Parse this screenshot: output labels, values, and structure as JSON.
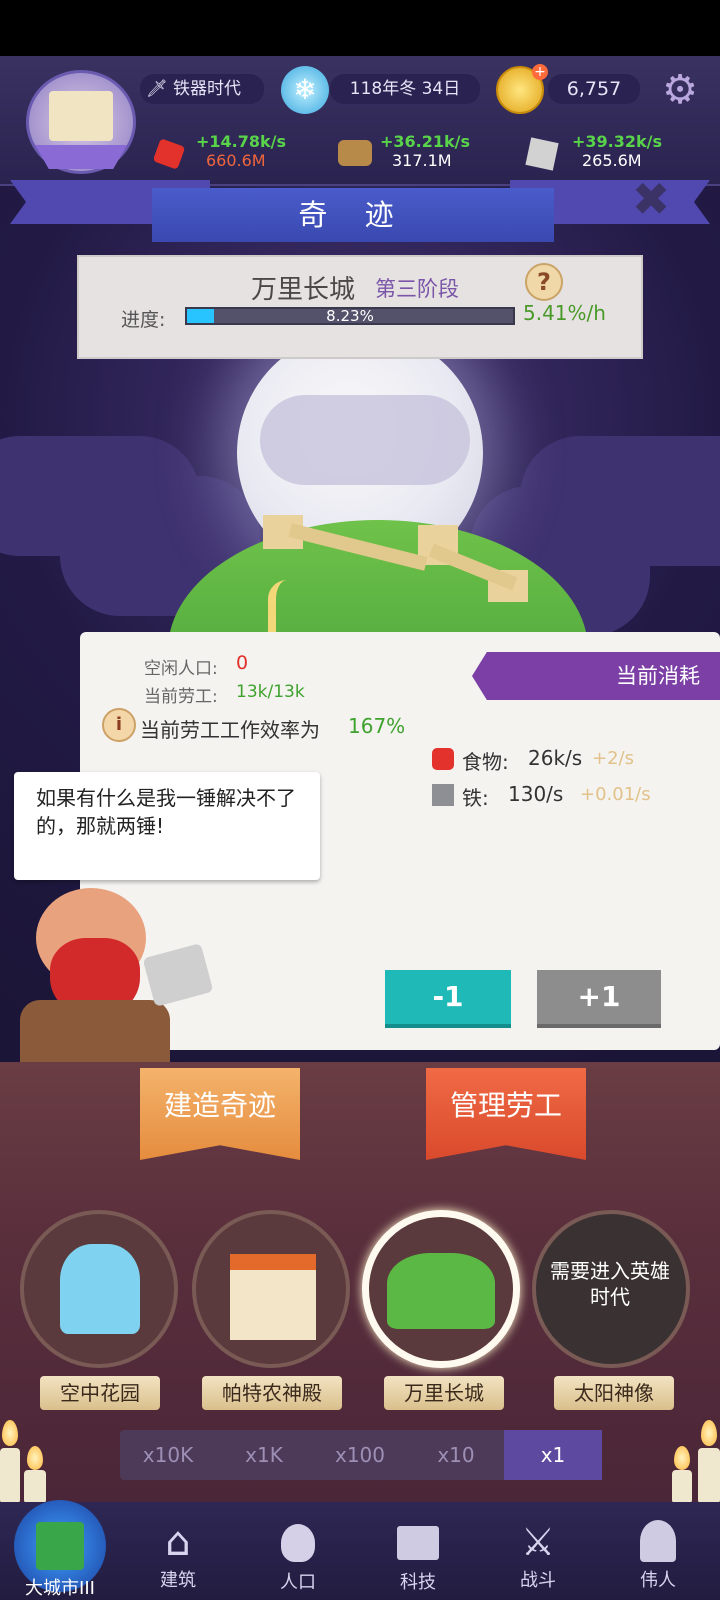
{
  "header": {
    "era": "铁器时代",
    "date": "118年冬 34日",
    "gold": "6,757"
  },
  "resources": [
    {
      "name": "food",
      "icon": "apple-icon",
      "rate": "+14.78k/s",
      "amount": "660.6M",
      "amount_color": "#f0653c"
    },
    {
      "name": "wood",
      "icon": "log-icon",
      "rate": "+36.21k/s",
      "amount": "317.1M",
      "amount_color": "#ffffff"
    },
    {
      "name": "iron",
      "icon": "iron-ore-icon",
      "rate": "+39.32k/s",
      "amount": "265.6M",
      "amount_color": "#ffffff"
    }
  ],
  "panel_title": "奇 迹",
  "wonder": {
    "name": "万里长城",
    "stage": "第三阶段",
    "progress_label": "进度:",
    "progress_text": "8.23%",
    "progress_fraction": 0.0823,
    "rate": "5.41%/h"
  },
  "workers": {
    "idle_label": "空闲人口:",
    "idle_value": "0",
    "current_label": "当前劳工:",
    "current_value": "13k/13k",
    "efficiency_label": "当前劳工工作效率为",
    "efficiency_value": "167%"
  },
  "consumption": {
    "title": "当前消耗",
    "items": [
      {
        "icon": "apple-icon",
        "label": "食物:",
        "value": "26k/s",
        "delta": "+2/s"
      },
      {
        "icon": "iron-ore-icon",
        "label": "铁:",
        "value": "130/s",
        "delta": "+0.01/s"
      }
    ]
  },
  "speech": "如果有什么是我一锤解决不了的，那就两锤!",
  "buttons": {
    "minus": "-1",
    "plus": "+1"
  },
  "tabs": {
    "build": "建造奇迹",
    "manage": "管理劳工"
  },
  "wonders_list": [
    {
      "name": "空中花园",
      "selected": false,
      "locked_text": ""
    },
    {
      "name": "帕特农神殿",
      "selected": false,
      "locked_text": ""
    },
    {
      "name": "万里长城",
      "selected": true,
      "locked_text": ""
    },
    {
      "name": "太阳神像",
      "selected": false,
      "locked_text": "需要进入英雄时代"
    }
  ],
  "multipliers": [
    "x10K",
    "x1K",
    "x100",
    "x10",
    "x1"
  ],
  "multiplier_selected": "x1",
  "nav": [
    {
      "label": "大城市III",
      "icon": "castle-icon",
      "active": true
    },
    {
      "label": "建筑",
      "icon": "house-icon",
      "active": false
    },
    {
      "label": "人口",
      "icon": "person-icon",
      "active": false
    },
    {
      "label": "科技",
      "icon": "book-icon",
      "active": false
    },
    {
      "label": "战斗",
      "icon": "crossed-swords-icon",
      "active": false
    },
    {
      "label": "伟人",
      "icon": "bust-icon",
      "active": false
    }
  ]
}
